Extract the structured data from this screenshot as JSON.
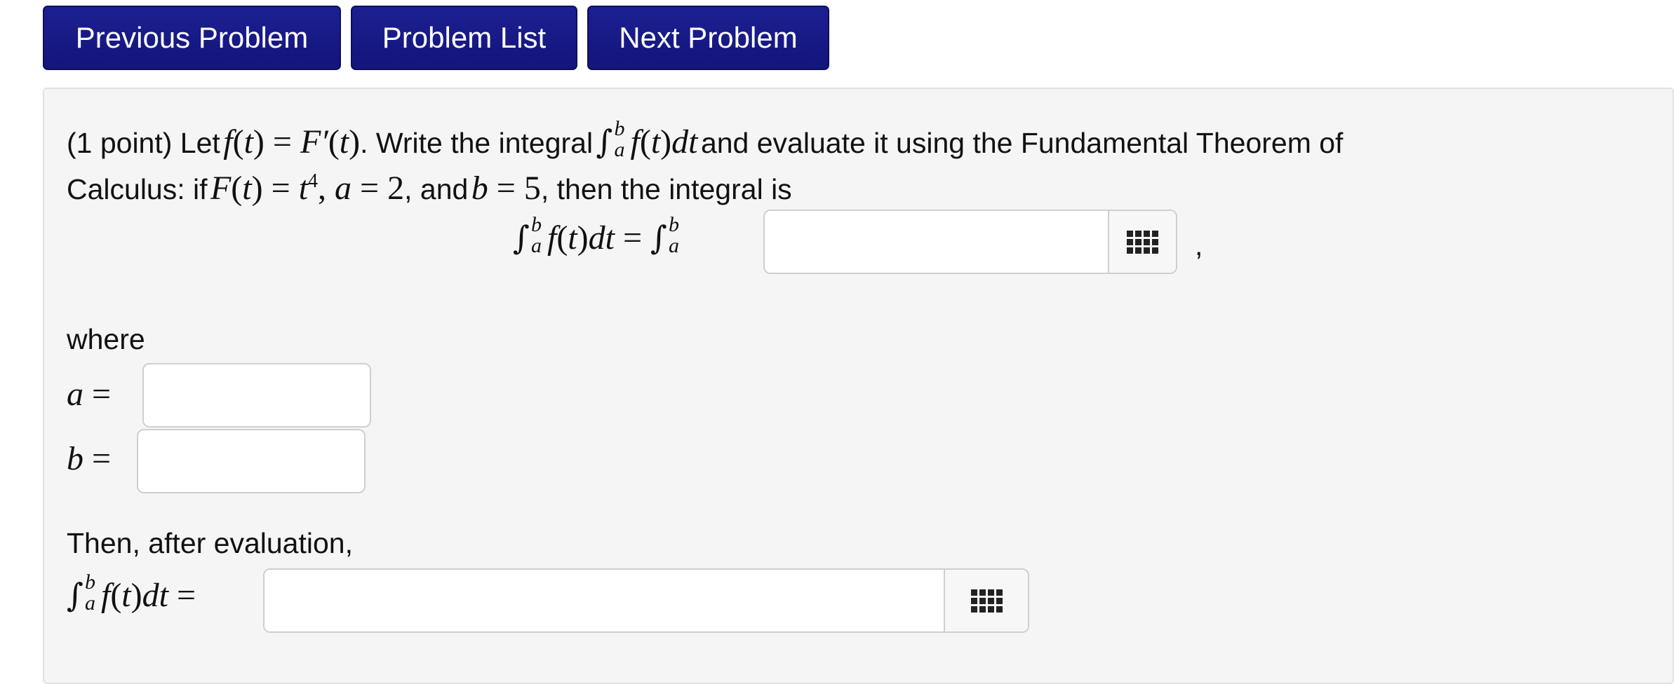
{
  "nav": {
    "previous": "Previous Problem",
    "list": "Problem List",
    "next": "Next Problem"
  },
  "problem": {
    "intro_points": "(1 point) Let",
    "intro_write": ". Write the integral",
    "intro_eval": "and evaluate it using the Fundamental Theorem of",
    "line2_calc": "Calculus: if",
    "line2_and": ", and",
    "line2_then": ", then the integral is",
    "comma": ",",
    "where": "where",
    "then_after": "Then, after evaluation,"
  },
  "answers": {
    "integrand_value": "",
    "a_value": "",
    "b_value": "",
    "result_value": ""
  },
  "icons": {
    "palette": "equation-palette-icon"
  }
}
